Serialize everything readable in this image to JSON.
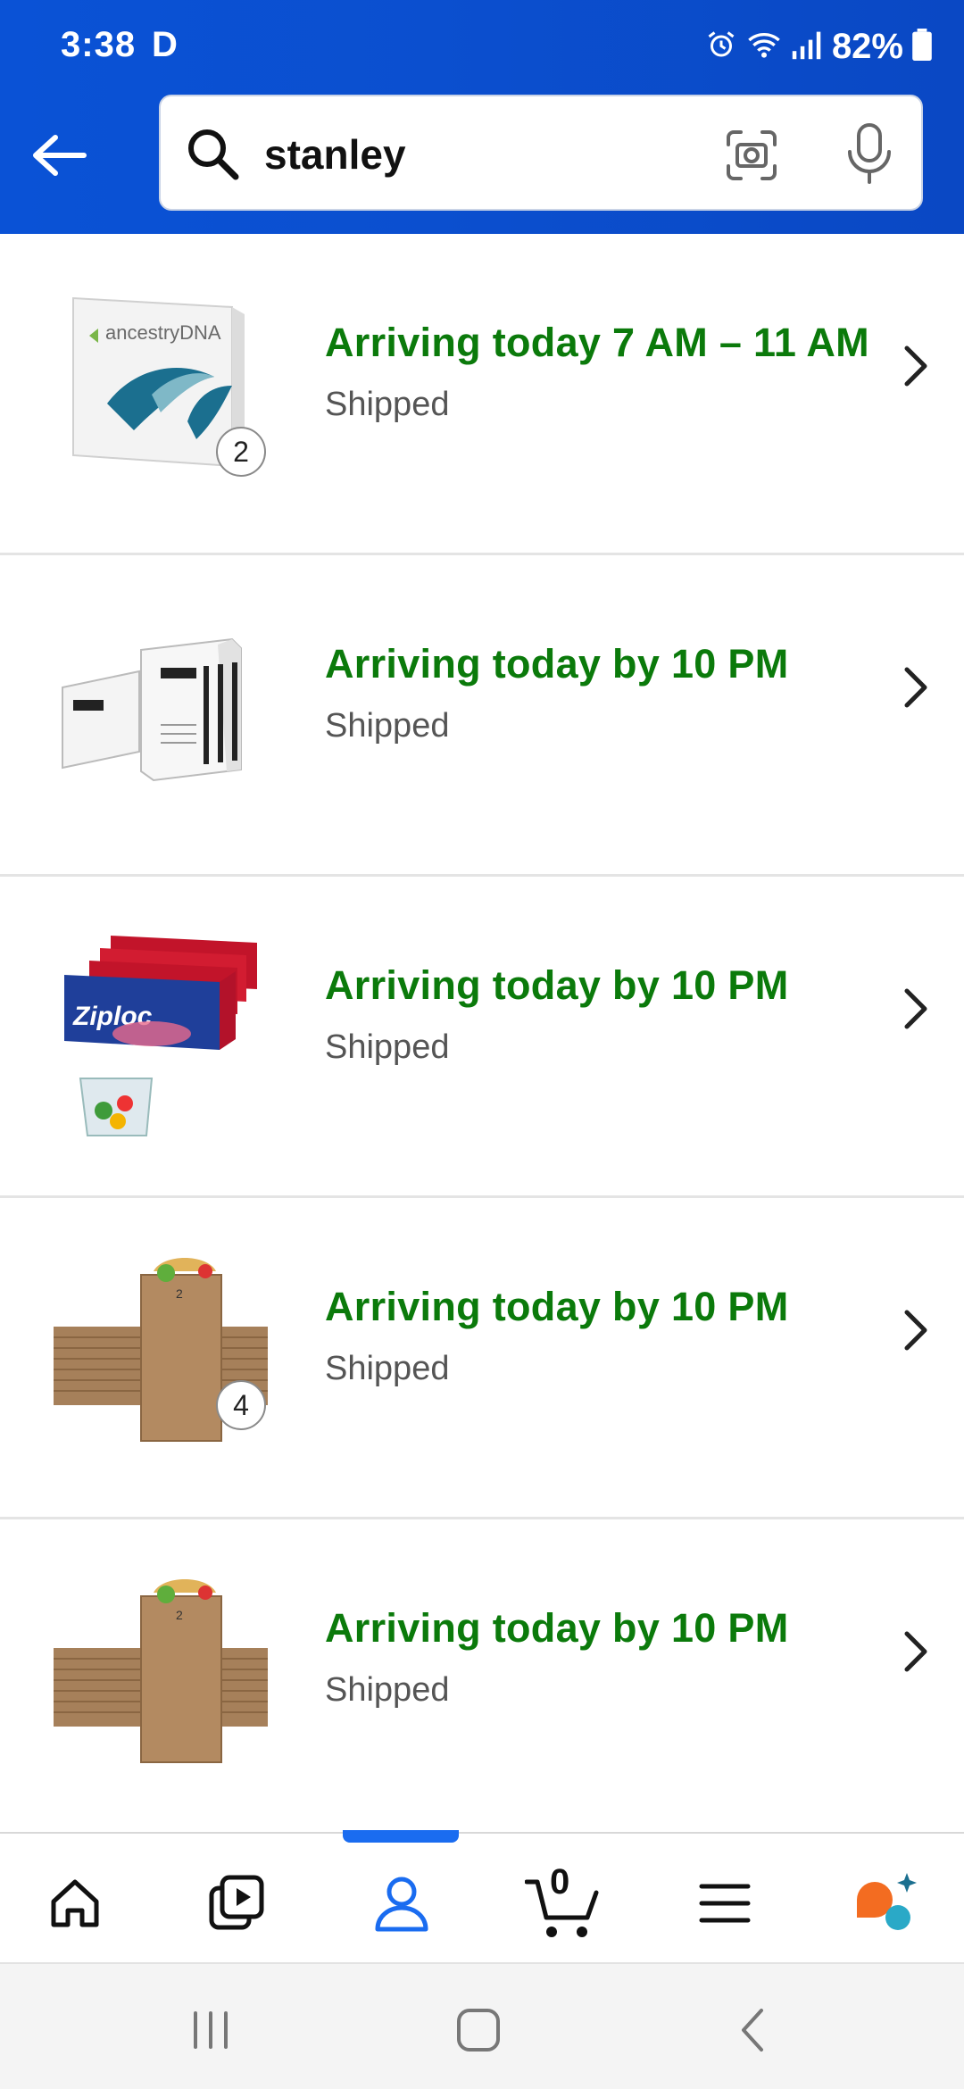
{
  "status_bar": {
    "time": "3:38",
    "carrier_glyph": "D",
    "battery": "82%",
    "icons": [
      "alarm-icon",
      "wifi-icon",
      "signal-icon",
      "battery-icon"
    ]
  },
  "search": {
    "query": "stanley",
    "icons": [
      "back-arrow-icon",
      "search-icon",
      "camera-icon",
      "mic-icon"
    ]
  },
  "orders": [
    {
      "status": "Arriving today 7 AM – 11 AM",
      "sub": "Shipped",
      "qty": "2",
      "image": "ancestry-dna-kit"
    },
    {
      "status": "Arriving today by 10 PM",
      "sub": "Shipped",
      "qty": "",
      "image": "copy-paper-boxes"
    },
    {
      "status": "Arriving today by 10 PM",
      "sub": "Shipped",
      "qty": "",
      "image": "ziploc-bags"
    },
    {
      "status": "Arriving today by 10 PM",
      "sub": "Shipped",
      "qty": "4",
      "image": "paper-bags"
    },
    {
      "status": "Arriving today by 10 PM",
      "sub": "Shipped",
      "qty": "",
      "image": "paper-bags"
    }
  ],
  "bottom_nav": {
    "items": [
      "home",
      "video",
      "account",
      "cart",
      "menu",
      "rufus"
    ],
    "active": "account",
    "cart_count": "0"
  },
  "colors": {
    "header": "#0a52d6",
    "arriving_green": "#0b7a0b",
    "active_blue": "#1a6cf0"
  }
}
